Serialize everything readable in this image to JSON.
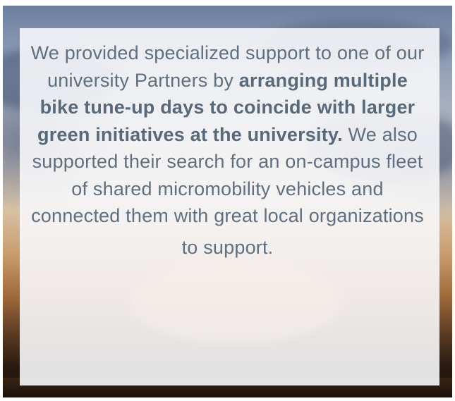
{
  "message": {
    "intro": "We provided specialized support to one of our university Partners by",
    "highlight": "arranging multiple bike tune-up days to coincide with larger green initiatives at the university.",
    "continuation": "We also supported their search for an on-campus fleet of shared micromobility vehicles and connected them with great local organizations",
    "closing": "to support."
  },
  "colors": {
    "text": "#5f6f80",
    "overlay": "#f7f7f9"
  }
}
